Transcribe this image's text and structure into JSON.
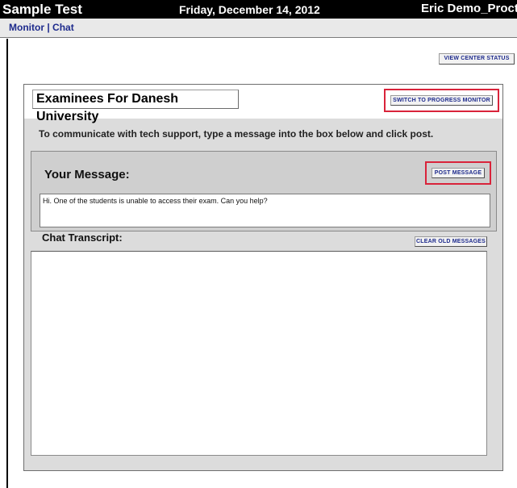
{
  "header": {
    "app_title": "Sample Test",
    "date": "Friday, December 14, 2012",
    "user": "Eric Demo_Proctor"
  },
  "nav": {
    "monitor_label": "Monitor",
    "separator": " | ",
    "chat_label": "Chat"
  },
  "toolbar": {
    "view_center_status_label": "VIEW CENTER STATUS"
  },
  "panel": {
    "title": "Examinees For Danesh University",
    "switch_button_label": "SWITCH TO PROGRESS MONITOR",
    "instructions": "To communicate with tech support, type a message into the box below and click post.",
    "message_label": "Your Message:",
    "post_button_label": "POST MESSAGE",
    "message_value": "Hi. One of the students is unable to access their exam. Can you help?",
    "transcript_label": "Chat Transcript:",
    "clear_button_label": "CLEAR OLD MESSAGES"
  },
  "colors": {
    "header_bg": "#000000",
    "nav_link": "#1d2a8c",
    "highlight": "#d9233a",
    "panel_bg": "#dcdcdc"
  }
}
